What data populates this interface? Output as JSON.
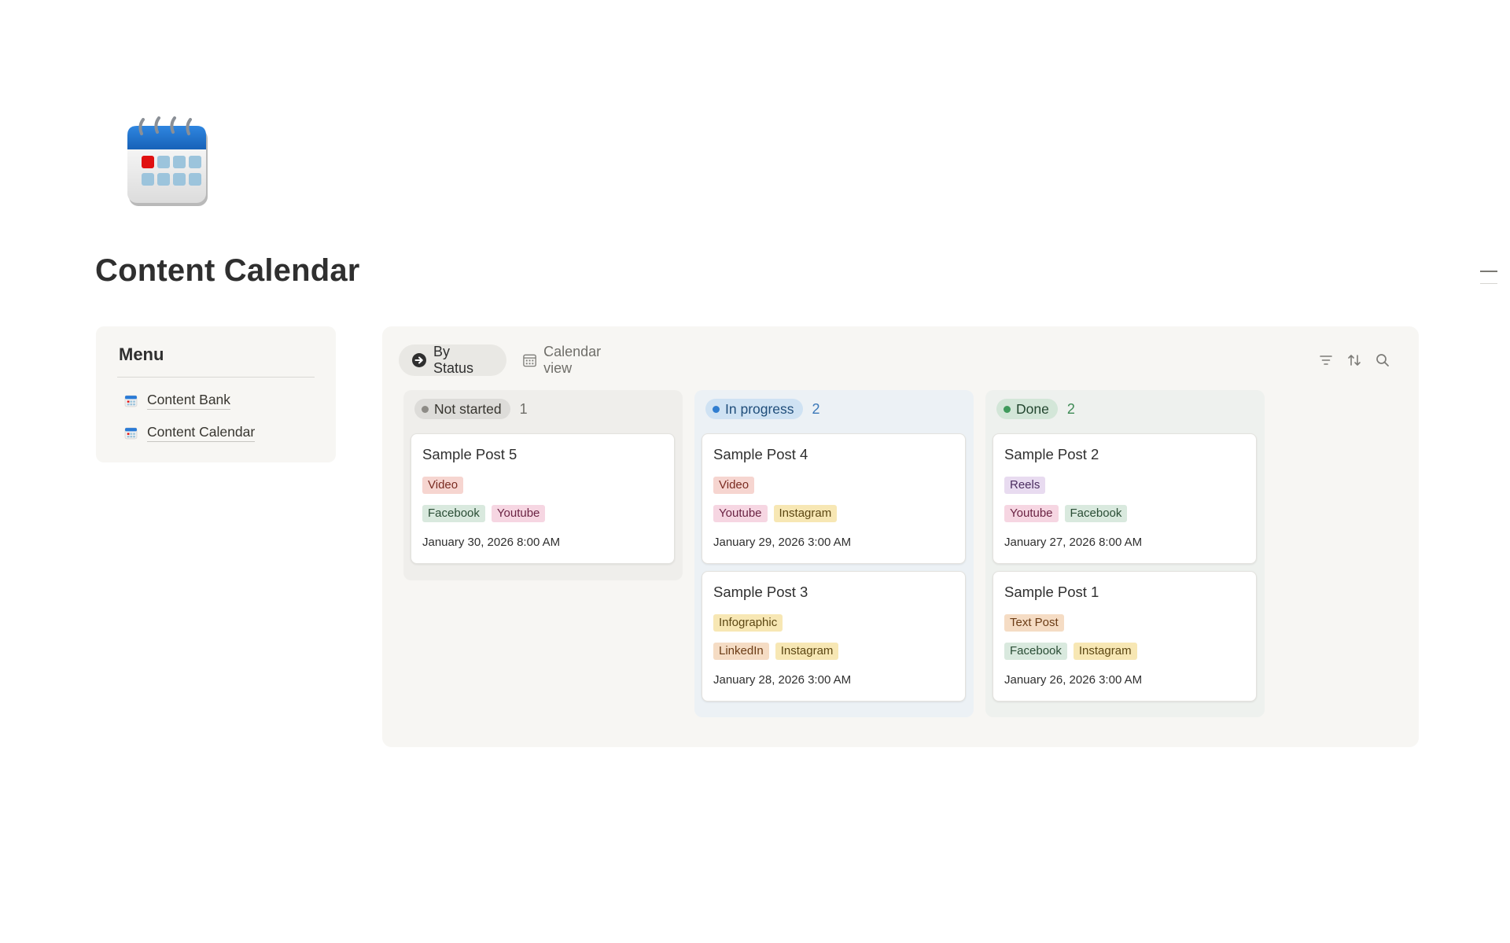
{
  "page": {
    "title": "Content Calendar",
    "icon": "calendar-icon"
  },
  "menu": {
    "title": "Menu",
    "items": [
      {
        "label": "Content Bank",
        "icon": "calendar-icon"
      },
      {
        "label": "Content Calendar",
        "icon": "calendar-icon"
      }
    ]
  },
  "views": [
    {
      "label": "By Status",
      "icon": "arrow-circle-icon",
      "active": true
    },
    {
      "label": "Calendar view",
      "icon": "calendar-grid-icon",
      "active": false
    }
  ],
  "toolbar": {
    "icons": [
      "filter-icon",
      "sort-icon",
      "search-icon"
    ]
  },
  "tag_colors": {
    "Video": {
      "bg": "#f6d5d0",
      "fg": "#7a2c22"
    },
    "Reels": {
      "bg": "#e8dbf0",
      "fg": "#4b2d60"
    },
    "Infographic": {
      "bg": "#f7e7b4",
      "fg": "#5c4713"
    },
    "Text Post": {
      "bg": "#f5dcc4",
      "fg": "#6b3c16"
    },
    "Facebook": {
      "bg": "#d9e9de",
      "fg": "#2a4d35"
    },
    "Youtube": {
      "bg": "#f6d6e2",
      "fg": "#6b2444"
    },
    "Instagram": {
      "bg": "#f7e7b4",
      "fg": "#5c4713"
    },
    "LinkedIn": {
      "bg": "#f5dcc4",
      "fg": "#6b3c16"
    }
  },
  "columns": [
    {
      "status": "Not started",
      "count": "1",
      "color": "#8d8b86",
      "cards": [
        {
          "title": "Sample Post 5",
          "type": [
            "Video"
          ],
          "platforms": [
            "Facebook",
            "Youtube"
          ],
          "date": "January 30, 2026 8:00 AM"
        }
      ]
    },
    {
      "status": "In progress",
      "count": "2",
      "color": "#2f7dd0",
      "cards": [
        {
          "title": "Sample Post 4",
          "type": [
            "Video"
          ],
          "platforms": [
            "Youtube",
            "Instagram"
          ],
          "date": "January 29, 2026 3:00 AM"
        },
        {
          "title": "Sample Post 3",
          "type": [
            "Infographic"
          ],
          "platforms": [
            "LinkedIn",
            "Instagram"
          ],
          "date": "January 28, 2026 3:00 AM"
        }
      ]
    },
    {
      "status": "Done",
      "count": "2",
      "color": "#3f9a5b",
      "cards": [
        {
          "title": "Sample Post 2",
          "type": [
            "Reels"
          ],
          "platforms": [
            "Youtube",
            "Facebook"
          ],
          "date": "January 27, 2026 8:00 AM"
        },
        {
          "title": "Sample Post 1",
          "type": [
            "Text Post"
          ],
          "platforms": [
            "Facebook",
            "Instagram"
          ],
          "date": "January 26, 2026 3:00 AM"
        }
      ]
    }
  ]
}
